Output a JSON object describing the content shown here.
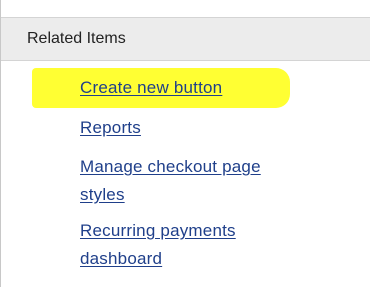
{
  "panel": {
    "title": "Related Items",
    "highlight_color": "#ffff33",
    "link_color": "#1f3f8a",
    "links": [
      {
        "label": "Create new button",
        "highlighted": true
      },
      {
        "label": "Reports",
        "highlighted": false
      },
      {
        "label_lines": [
          "Manage checkout page",
          "styles"
        ],
        "highlighted": false
      },
      {
        "label_lines": [
          "Recurring payments",
          "dashboard"
        ],
        "highlighted": false
      }
    ]
  }
}
